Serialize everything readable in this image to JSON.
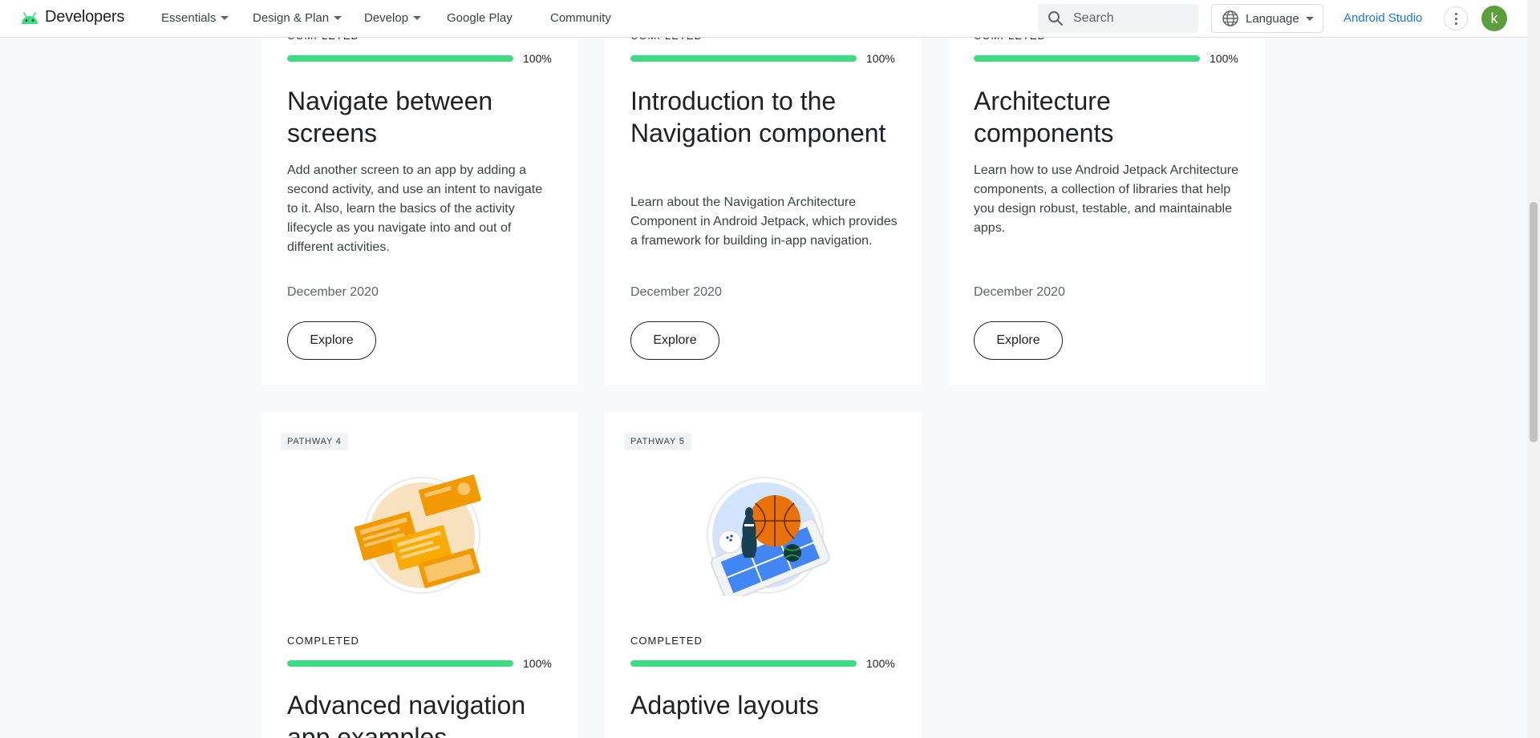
{
  "header": {
    "logo_text": "Developers",
    "nav": [
      {
        "label": "Essentials",
        "dropdown": true
      },
      {
        "label": "Design & Plan",
        "dropdown": true
      },
      {
        "label": "Develop",
        "dropdown": true
      },
      {
        "label": "Google Play",
        "dropdown": false
      },
      {
        "label": "Community",
        "dropdown": false
      }
    ],
    "search_placeholder": "Search",
    "language_label": "Language",
    "studio_link": "Android Studio",
    "avatar_letter": "k"
  },
  "colors": {
    "accent": "#3ddc84",
    "link": "#1a73e8",
    "avatar": "#5b9e3b"
  },
  "top_cards": [
    {
      "status": "COMPLETED",
      "progress_pct": "100%",
      "progress": 1.0,
      "title": "Navigate between screens",
      "description": "Add another screen to an app by adding a second activity, and use an intent to navigate to it. Also, learn the basics of the activity lifecycle as you navigate into and out of different activities.",
      "date": "December 2020",
      "button": "Explore"
    },
    {
      "status": "COMPLETED",
      "progress_pct": "100%",
      "progress": 1.0,
      "title": "Introduction to the Navigation component",
      "description": "Learn about the Navigation Architecture Component in Android Jetpack, which provides a framework for building in-app navigation.",
      "date": "December 2020",
      "button": "Explore"
    },
    {
      "status": "COMPLETED",
      "progress_pct": "100%",
      "progress": 1.0,
      "title": "Architecture components",
      "description": "Learn how to use Android Jetpack Architecture components, a collection of libraries that help you design robust, testable, and maintainable apps.",
      "date": "December 2020",
      "button": "Explore"
    }
  ],
  "bottom_cards": [
    {
      "pathway": "PATHWAY 4",
      "illustration": "layout-screens-illustration",
      "status": "COMPLETED",
      "progress_pct": "100%",
      "progress": 1.0,
      "title": "Advanced navigation app examples"
    },
    {
      "pathway": "PATHWAY 5",
      "illustration": "adaptive-sports-illustration",
      "status": "COMPLETED",
      "progress_pct": "100%",
      "progress": 1.0,
      "title": "Adaptive layouts"
    }
  ]
}
